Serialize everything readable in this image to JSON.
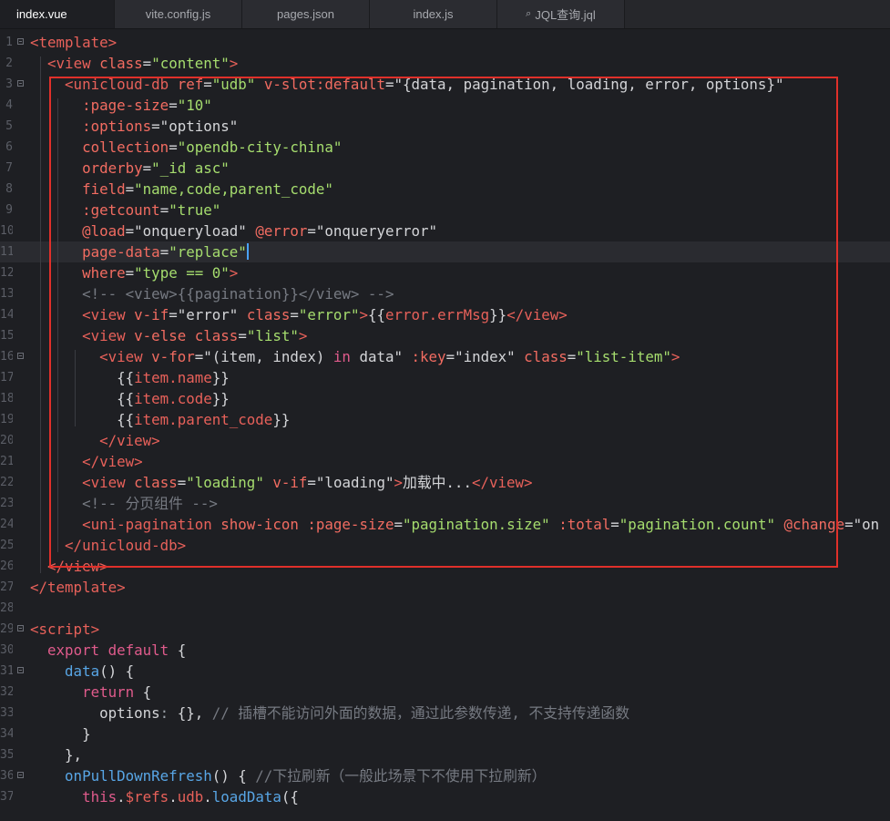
{
  "tabs": [
    {
      "label": "index.vue",
      "active": true
    },
    {
      "label": "vite.config.js"
    },
    {
      "label": "pages.json"
    },
    {
      "label": "index.js"
    },
    {
      "label": "JQL查询.jql",
      "icon": "search-db-icon"
    }
  ],
  "line_numbers": [
    "1",
    "2",
    "3",
    "4",
    "5",
    "6",
    "7",
    "8",
    "9",
    "10",
    "11",
    "12",
    "13",
    "14",
    "15",
    "16",
    "17",
    "18",
    "19",
    "20",
    "21",
    "22",
    "23",
    "24",
    "25",
    "26",
    "27",
    "28",
    "29",
    "30",
    "31",
    "32",
    "33",
    "34",
    "35",
    "36",
    "37"
  ],
  "lines": [
    [
      [
        "t-tag",
        "<template>"
      ]
    ],
    [
      [
        "t-txt",
        "  "
      ],
      [
        "t-tag",
        "<view "
      ],
      [
        "t-attr",
        "class"
      ],
      [
        "t-txt",
        "="
      ],
      [
        "t-str",
        "\"content\""
      ],
      [
        "t-tag",
        ">"
      ]
    ],
    [
      [
        "t-txt",
        "    "
      ],
      [
        "t-tag",
        "<unicloud-db "
      ],
      [
        "t-attr",
        "ref"
      ],
      [
        "t-txt",
        "="
      ],
      [
        "t-str",
        "\"udb\""
      ],
      [
        "t-txt",
        " "
      ],
      [
        "t-attr",
        "v-slot:default"
      ],
      [
        "t-txt",
        "=\"{data, pagination, loading, error, options}\""
      ]
    ],
    [
      [
        "t-txt",
        "      "
      ],
      [
        "t-attr",
        ":page-size"
      ],
      [
        "t-txt",
        "="
      ],
      [
        "t-str",
        "\"10\""
      ]
    ],
    [
      [
        "t-txt",
        "      "
      ],
      [
        "t-attr",
        ":options"
      ],
      [
        "t-txt",
        "=\"options\""
      ]
    ],
    [
      [
        "t-txt",
        "      "
      ],
      [
        "t-attr",
        "collection"
      ],
      [
        "t-txt",
        "="
      ],
      [
        "t-str",
        "\"opendb-city-china\""
      ]
    ],
    [
      [
        "t-txt",
        "      "
      ],
      [
        "t-attr",
        "orderby"
      ],
      [
        "t-txt",
        "="
      ],
      [
        "t-str",
        "\"_id asc\""
      ]
    ],
    [
      [
        "t-txt",
        "      "
      ],
      [
        "t-attr",
        "field"
      ],
      [
        "t-txt",
        "="
      ],
      [
        "t-str",
        "\"name,code,parent_code\""
      ]
    ],
    [
      [
        "t-txt",
        "      "
      ],
      [
        "t-attr",
        ":getcount"
      ],
      [
        "t-txt",
        "="
      ],
      [
        "t-str",
        "\"true\""
      ]
    ],
    [
      [
        "t-txt",
        "      "
      ],
      [
        "t-attr",
        "@load"
      ],
      [
        "t-txt",
        "=\"onqueryload\" "
      ],
      [
        "t-attr",
        "@error"
      ],
      [
        "t-txt",
        "=\"onqueryerror\""
      ]
    ],
    [
      [
        "t-txt",
        "      "
      ],
      [
        "t-attr",
        "page-data"
      ],
      [
        "t-txt",
        "="
      ],
      [
        "t-str",
        "\"replace\""
      ]
    ],
    [
      [
        "t-txt",
        "      "
      ],
      [
        "t-attr",
        "where"
      ],
      [
        "t-txt",
        "="
      ],
      [
        "t-str",
        "\"type == 0\""
      ],
      [
        "t-tag",
        ">"
      ]
    ],
    [
      [
        "t-txt",
        "      "
      ],
      [
        "t-com",
        "<!-- <view>{{pagination}}</view> -->"
      ]
    ],
    [
      [
        "t-txt",
        "      "
      ],
      [
        "t-tag",
        "<view "
      ],
      [
        "t-attr",
        "v-if"
      ],
      [
        "t-txt",
        "=\"error\" "
      ],
      [
        "t-attr",
        "class"
      ],
      [
        "t-txt",
        "="
      ],
      [
        "t-str",
        "\"error\""
      ],
      [
        "t-tag",
        ">"
      ],
      [
        "t-txt",
        "{{"
      ],
      [
        "t-var",
        "error.errMsg"
      ],
      [
        "t-txt",
        "}}"
      ],
      [
        "t-tag",
        "</view>"
      ]
    ],
    [
      [
        "t-txt",
        "      "
      ],
      [
        "t-tag",
        "<view "
      ],
      [
        "t-attr",
        "v-else"
      ],
      [
        "t-txt",
        " "
      ],
      [
        "t-attr",
        "class"
      ],
      [
        "t-txt",
        "="
      ],
      [
        "t-str",
        "\"list\""
      ],
      [
        "t-tag",
        ">"
      ]
    ],
    [
      [
        "t-txt",
        "        "
      ],
      [
        "t-tag",
        "<view "
      ],
      [
        "t-attr",
        "v-for"
      ],
      [
        "t-txt",
        "=\"(item, index) "
      ],
      [
        "t-kw",
        "in"
      ],
      [
        "t-txt",
        " data\" "
      ],
      [
        "t-attr",
        ":key"
      ],
      [
        "t-txt",
        "=\"index\" "
      ],
      [
        "t-attr",
        "class"
      ],
      [
        "t-txt",
        "="
      ],
      [
        "t-str",
        "\"list-item\""
      ],
      [
        "t-tag",
        ">"
      ]
    ],
    [
      [
        "t-txt",
        "          {{"
      ],
      [
        "t-var",
        "item.name"
      ],
      [
        "t-txt",
        "}}"
      ]
    ],
    [
      [
        "t-txt",
        "          {{"
      ],
      [
        "t-var",
        "item.code"
      ],
      [
        "t-txt",
        "}}"
      ]
    ],
    [
      [
        "t-txt",
        "          {{"
      ],
      [
        "t-var",
        "item.parent_code"
      ],
      [
        "t-txt",
        "}}"
      ]
    ],
    [
      [
        "t-txt",
        "        "
      ],
      [
        "t-tag",
        "</view>"
      ]
    ],
    [
      [
        "t-txt",
        "      "
      ],
      [
        "t-tag",
        "</view>"
      ]
    ],
    [
      [
        "t-txt",
        "      "
      ],
      [
        "t-tag",
        "<view "
      ],
      [
        "t-attr",
        "class"
      ],
      [
        "t-txt",
        "="
      ],
      [
        "t-str",
        "\"loading\""
      ],
      [
        "t-txt",
        " "
      ],
      [
        "t-attr",
        "v-if"
      ],
      [
        "t-txt",
        "=\"loading\""
      ],
      [
        "t-tag",
        ">"
      ],
      [
        "t-txt",
        "加载中..."
      ],
      [
        "t-tag",
        "</view>"
      ]
    ],
    [
      [
        "t-txt",
        "      "
      ],
      [
        "t-com",
        "<!-- 分页组件 -->"
      ]
    ],
    [
      [
        "t-txt",
        "      "
      ],
      [
        "t-tag",
        "<uni-pagination "
      ],
      [
        "t-attr",
        "show-icon"
      ],
      [
        "t-txt",
        " "
      ],
      [
        "t-attr",
        ":page-size"
      ],
      [
        "t-txt",
        "="
      ],
      [
        "t-str",
        "\"pagination.size\""
      ],
      [
        "t-txt",
        " "
      ],
      [
        "t-attr",
        ":total"
      ],
      [
        "t-txt",
        "="
      ],
      [
        "t-str",
        "\"pagination.count\""
      ],
      [
        "t-txt",
        " "
      ],
      [
        "t-attr",
        "@change"
      ],
      [
        "t-txt",
        "=\"on"
      ]
    ],
    [
      [
        "t-txt",
        "    "
      ],
      [
        "t-tag",
        "</unicloud-db>"
      ]
    ],
    [
      [
        "t-txt",
        "  "
      ],
      [
        "t-tag",
        "</view>"
      ]
    ],
    [
      [
        "t-tag",
        "</template>"
      ]
    ],
    [
      [
        "t-txt",
        ""
      ]
    ],
    [
      [
        "t-tag",
        "<script>"
      ]
    ],
    [
      [
        "t-txt",
        "  "
      ],
      [
        "t-kw",
        "export default"
      ],
      [
        "t-txt",
        " {"
      ]
    ],
    [
      [
        "t-txt",
        "    "
      ],
      [
        "t-fn",
        "data"
      ],
      [
        "t-txt",
        "() {"
      ]
    ],
    [
      [
        "t-txt",
        "      "
      ],
      [
        "t-kw",
        "return"
      ],
      [
        "t-txt",
        " {"
      ]
    ],
    [
      [
        "t-txt",
        "        options"
      ],
      [
        "t-op",
        ":"
      ],
      [
        "t-txt",
        " {}, "
      ],
      [
        "t-com",
        "// 插槽不能访问外面的数据，通过此参数传递, 不支持传递函数"
      ]
    ],
    [
      [
        "t-txt",
        "      }"
      ]
    ],
    [
      [
        "t-txt",
        "    },"
      ]
    ],
    [
      [
        "t-txt",
        "    "
      ],
      [
        "t-fn",
        "onPullDownRefresh"
      ],
      [
        "t-txt",
        "() { "
      ],
      [
        "t-com",
        "//下拉刷新（一般此场景下不使用下拉刷新）"
      ]
    ],
    [
      [
        "t-txt",
        "      "
      ],
      [
        "t-kw",
        "this"
      ],
      [
        "t-txt",
        "."
      ],
      [
        "t-var",
        "$refs"
      ],
      [
        "t-txt",
        "."
      ],
      [
        "t-var",
        "udb"
      ],
      [
        "t-txt",
        "."
      ],
      [
        "t-fn",
        "loadData"
      ],
      [
        "t-txt",
        "({"
      ]
    ]
  ],
  "current_line": 11,
  "fold_lines": [
    1,
    3,
    16,
    29,
    31,
    36
  ],
  "selection_box": "highlight"
}
